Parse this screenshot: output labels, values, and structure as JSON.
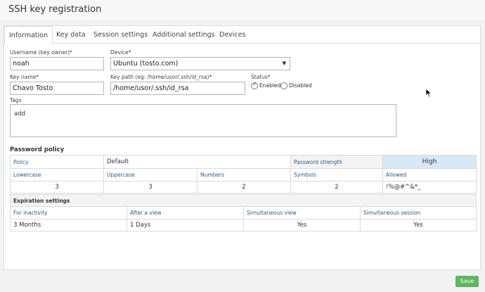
{
  "window": {
    "title": "SSH key registration"
  },
  "tabs": [
    {
      "label": "Information"
    },
    {
      "label": "Key data"
    },
    {
      "label": "Session settings"
    },
    {
      "label": "Additional settings"
    },
    {
      "label": "Devices"
    }
  ],
  "form": {
    "username_label": "Username (key owner)*",
    "username_value": "noah",
    "device_label": "Device*",
    "device_value": "Ubuntu (tosto.com)",
    "keyname_label": "Key name*",
    "keyname_value": "Chavo Tosto",
    "keypath_label": "Key path (eg: /home/usor/.ssh/id_rsa)*",
    "keypath_value": "/home/usor/.ssh/id_rsa",
    "status_label": "Status*",
    "status_enabled": "Enabled",
    "status_disabled": "Disabled",
    "tags_label": "Tags",
    "tags_value": "add"
  },
  "password_policy": {
    "title": "Password policy",
    "policy_label": "Policy",
    "policy_value": "Default",
    "strength_label": "Password strength",
    "strength_value": "High",
    "headers": [
      "Lowercase",
      "Uppercase",
      "Numbers",
      "Symbols",
      "Allowed"
    ],
    "values": [
      "3",
      "3",
      "2",
      "2",
      "!%@#^&*_"
    ]
  },
  "expiration": {
    "title": "Expiration settings",
    "headers": [
      "For inactivity",
      "After a view",
      "Simultaneous view",
      "Simultaneous session"
    ],
    "values": [
      "3 Months",
      "1 Days",
      "Yes",
      "Yes"
    ]
  },
  "actions": {
    "save_label": "Save"
  },
  "colors": {
    "accent_blue": "#d6e8f6",
    "save_green": "#5cb85c",
    "header_text": "#2b5d86"
  }
}
